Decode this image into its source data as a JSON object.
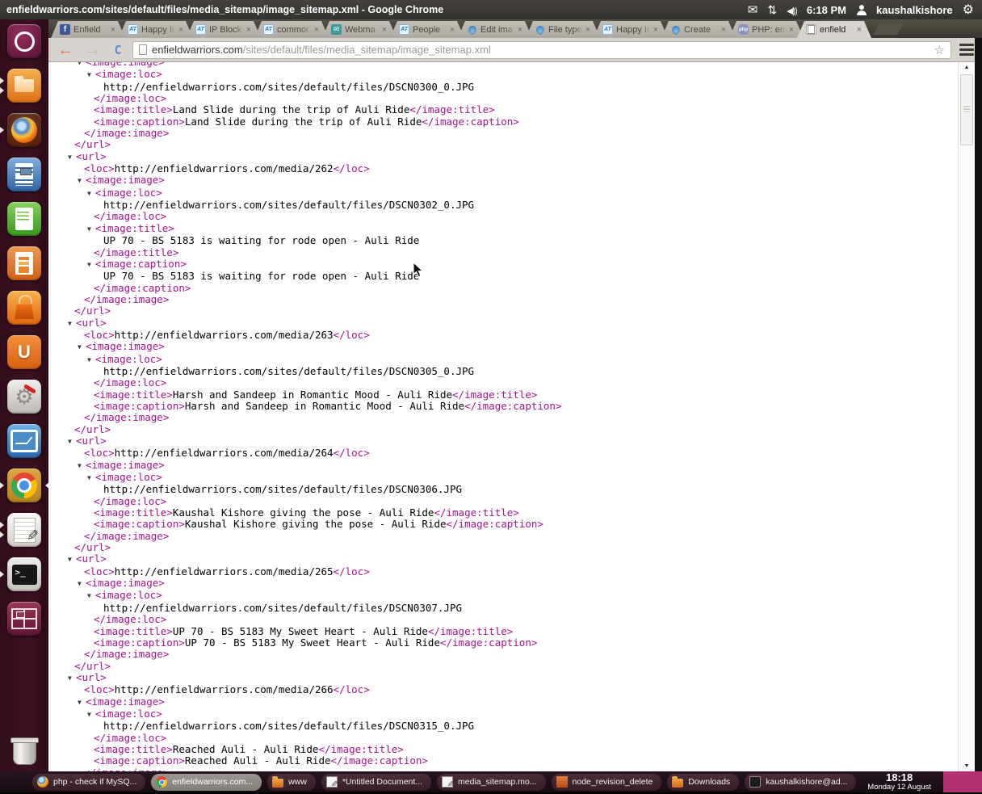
{
  "window": {
    "title": "enfieldwarriors.com/sites/default/files/media_sitemap/image_sitemap.xml - Google Chrome"
  },
  "tray": {
    "time": "6:18 PM",
    "user": "kaushalkishore",
    "icons": [
      "mail-icon",
      "sync-arrows-icon",
      "volume-icon",
      "user-icon",
      "session-gear-icon"
    ]
  },
  "tabs": [
    {
      "label": "Enfield",
      "favicon": "facebook",
      "active": false
    },
    {
      "label": "Happy Ir",
      "favicon": "at",
      "active": false
    },
    {
      "label": "IP Block",
      "favicon": "at",
      "active": false
    },
    {
      "label": "commor",
      "favicon": "at",
      "active": false
    },
    {
      "label": "Webma",
      "favicon": "webmail",
      "active": false
    },
    {
      "label": "People",
      "favicon": "at",
      "active": false
    },
    {
      "label": "Edit ima",
      "favicon": "drupal",
      "active": false
    },
    {
      "label": "File type",
      "favicon": "drupal",
      "active": false
    },
    {
      "label": "Happy Ir",
      "favicon": "at",
      "active": false
    },
    {
      "label": "Create",
      "favicon": "drupal",
      "active": false
    },
    {
      "label": "PHP: em",
      "favicon": "php",
      "active": false
    },
    {
      "label": "enfield",
      "favicon": "document",
      "active": true
    }
  ],
  "toolbar": {
    "url_host": "enfieldwarriors.com",
    "url_path": "/sites/default/files/media_sitemap/image_sitemap.xml"
  },
  "launcher": [
    {
      "name": "ubuntu-dash",
      "style": "ubuntu",
      "slot": 0,
      "pips": 0,
      "focused": false,
      "glyph": ""
    },
    {
      "name": "files",
      "style": "files",
      "slot": 1,
      "pips": 2,
      "focused": false,
      "glyph": ""
    },
    {
      "name": "firefox",
      "style": "firefox",
      "slot": 2,
      "pips": 1,
      "focused": false,
      "glyph": ""
    },
    {
      "name": "libreoffice-writer",
      "style": "writer",
      "slot": 3,
      "pips": 0,
      "focused": false,
      "glyph": ""
    },
    {
      "name": "libreoffice-calc",
      "style": "calc",
      "slot": 4,
      "pips": 0,
      "focused": false,
      "glyph": ""
    },
    {
      "name": "libreoffice-impress",
      "style": "impress",
      "slot": 5,
      "pips": 0,
      "focused": false,
      "glyph": ""
    },
    {
      "name": "software-center",
      "style": "usc",
      "slot": 6,
      "pips": 0,
      "focused": false,
      "glyph": ""
    },
    {
      "name": "ubuntu-one",
      "style": "uone",
      "slot": 7,
      "pips": 0,
      "focused": false,
      "glyph": "U"
    },
    {
      "name": "system-settings",
      "style": "settings",
      "slot": 8,
      "pips": 0,
      "focused": false,
      "glyph": ""
    },
    {
      "name": "system-monitor",
      "style": "monitor",
      "slot": 9,
      "pips": 0,
      "focused": false,
      "glyph": ""
    },
    {
      "name": "google-chrome",
      "style": "chrome",
      "slot": 10,
      "pips": 1,
      "focused": true,
      "glyph": ""
    },
    {
      "name": "gedit",
      "style": "gedit",
      "slot": 11,
      "pips": 2,
      "focused": false,
      "glyph": ""
    },
    {
      "name": "terminal",
      "style": "terminal",
      "slot": 12,
      "pips": 1,
      "focused": false,
      "glyph": ">_"
    },
    {
      "name": "workspace-switcher",
      "style": "workspace",
      "slot": 13,
      "pips": 0,
      "focused": false,
      "glyph": ""
    },
    {
      "name": "trash",
      "style": "trash",
      "slot": 16,
      "pips": 0,
      "focused": false,
      "glyph": ""
    }
  ],
  "xml": {
    "tag_color": "#a3148c",
    "lines": [
      {
        "a": 1,
        "i": 1,
        "s": [
          [
            "t",
            "<image:image>"
          ]
        ]
      },
      {
        "a": 1,
        "i": 2,
        "s": [
          [
            "t",
            "<image:loc>"
          ]
        ]
      },
      {
        "a": 0,
        "i": 3,
        "s": [
          [
            "x",
            "http://enfieldwarriors.com/sites/default/files/DSCN0300_0.JPG"
          ]
        ]
      },
      {
        "a": 0,
        "i": 2,
        "s": [
          [
            "t",
            "</image:loc>"
          ]
        ]
      },
      {
        "a": 0,
        "i": 2,
        "s": [
          [
            "t",
            "<image:title>"
          ],
          [
            "x",
            "Land Slide during the trip of Auli Ride"
          ],
          [
            "t",
            "</image:title>"
          ]
        ]
      },
      {
        "a": 0,
        "i": 2,
        "s": [
          [
            "t",
            "<image:caption>"
          ],
          [
            "x",
            "Land Slide during the trip of Auli Ride"
          ],
          [
            "t",
            "</image:caption>"
          ]
        ]
      },
      {
        "a": 0,
        "i": 1,
        "s": [
          [
            "t",
            "</image:image>"
          ]
        ]
      },
      {
        "a": 0,
        "i": 0,
        "s": [
          [
            "t",
            "</url>"
          ]
        ]
      },
      {
        "a": 1,
        "i": 0,
        "s": [
          [
            "t",
            "<url>"
          ]
        ]
      },
      {
        "a": 0,
        "i": 1,
        "s": [
          [
            "t",
            "<loc>"
          ],
          [
            "x",
            "http://enfieldwarriors.com/media/262"
          ],
          [
            "t",
            "</loc>"
          ]
        ]
      },
      {
        "a": 1,
        "i": 1,
        "s": [
          [
            "t",
            "<image:image>"
          ]
        ]
      },
      {
        "a": 1,
        "i": 2,
        "s": [
          [
            "t",
            "<image:loc>"
          ]
        ]
      },
      {
        "a": 0,
        "i": 3,
        "s": [
          [
            "x",
            "http://enfieldwarriors.com/sites/default/files/DSCN0302_0.JPG"
          ]
        ]
      },
      {
        "a": 0,
        "i": 2,
        "s": [
          [
            "t",
            "</image:loc>"
          ]
        ]
      },
      {
        "a": 1,
        "i": 2,
        "s": [
          [
            "t",
            "<image:title>"
          ]
        ]
      },
      {
        "a": 0,
        "i": 3,
        "s": [
          [
            "x",
            "UP 70 - BS 5183 is waiting for rode open - Auli Ride"
          ]
        ]
      },
      {
        "a": 0,
        "i": 2,
        "s": [
          [
            "t",
            "</image:title>"
          ]
        ]
      },
      {
        "a": 1,
        "i": 2,
        "s": [
          [
            "t",
            "<image:caption>"
          ]
        ]
      },
      {
        "a": 0,
        "i": 3,
        "s": [
          [
            "x",
            "UP 70 - BS 5183 is waiting for rode open - Auli Ride"
          ]
        ]
      },
      {
        "a": 0,
        "i": 2,
        "s": [
          [
            "t",
            "</image:caption>"
          ]
        ]
      },
      {
        "a": 0,
        "i": 1,
        "s": [
          [
            "t",
            "</image:image>"
          ]
        ]
      },
      {
        "a": 0,
        "i": 0,
        "s": [
          [
            "t",
            "</url>"
          ]
        ]
      },
      {
        "a": 1,
        "i": 0,
        "s": [
          [
            "t",
            "<url>"
          ]
        ]
      },
      {
        "a": 0,
        "i": 1,
        "s": [
          [
            "t",
            "<loc>"
          ],
          [
            "x",
            "http://enfieldwarriors.com/media/263"
          ],
          [
            "t",
            "</loc>"
          ]
        ]
      },
      {
        "a": 1,
        "i": 1,
        "s": [
          [
            "t",
            "<image:image>"
          ]
        ]
      },
      {
        "a": 1,
        "i": 2,
        "s": [
          [
            "t",
            "<image:loc>"
          ]
        ]
      },
      {
        "a": 0,
        "i": 3,
        "s": [
          [
            "x",
            "http://enfieldwarriors.com/sites/default/files/DSCN0305_0.JPG"
          ]
        ]
      },
      {
        "a": 0,
        "i": 2,
        "s": [
          [
            "t",
            "</image:loc>"
          ]
        ]
      },
      {
        "a": 0,
        "i": 2,
        "s": [
          [
            "t",
            "<image:title>"
          ],
          [
            "x",
            "Harsh and Sandeep in Romantic Mood - Auli Ride"
          ],
          [
            "t",
            "</image:title>"
          ]
        ]
      },
      {
        "a": 0,
        "i": 2,
        "s": [
          [
            "t",
            "<image:caption>"
          ],
          [
            "x",
            "Harsh and Sandeep in Romantic Mood - Auli Ride"
          ],
          [
            "t",
            "</image:caption>"
          ]
        ]
      },
      {
        "a": 0,
        "i": 1,
        "s": [
          [
            "t",
            "</image:image>"
          ]
        ]
      },
      {
        "a": 0,
        "i": 0,
        "s": [
          [
            "t",
            "</url>"
          ]
        ]
      },
      {
        "a": 1,
        "i": 0,
        "s": [
          [
            "t",
            "<url>"
          ]
        ]
      },
      {
        "a": 0,
        "i": 1,
        "s": [
          [
            "t",
            "<loc>"
          ],
          [
            "x",
            "http://enfieldwarriors.com/media/264"
          ],
          [
            "t",
            "</loc>"
          ]
        ]
      },
      {
        "a": 1,
        "i": 1,
        "s": [
          [
            "t",
            "<image:image>"
          ]
        ]
      },
      {
        "a": 1,
        "i": 2,
        "s": [
          [
            "t",
            "<image:loc>"
          ]
        ]
      },
      {
        "a": 0,
        "i": 3,
        "s": [
          [
            "x",
            "http://enfieldwarriors.com/sites/default/files/DSCN0306.JPG"
          ]
        ]
      },
      {
        "a": 0,
        "i": 2,
        "s": [
          [
            "t",
            "</image:loc>"
          ]
        ]
      },
      {
        "a": 0,
        "i": 2,
        "s": [
          [
            "t",
            "<image:title>"
          ],
          [
            "x",
            "Kaushal Kishore giving the pose - Auli Ride"
          ],
          [
            "t",
            "</image:title>"
          ]
        ]
      },
      {
        "a": 0,
        "i": 2,
        "s": [
          [
            "t",
            "<image:caption>"
          ],
          [
            "x",
            "Kaushal Kishore giving the pose - Auli Ride"
          ],
          [
            "t",
            "</image:caption>"
          ]
        ]
      },
      {
        "a": 0,
        "i": 1,
        "s": [
          [
            "t",
            "</image:image>"
          ]
        ]
      },
      {
        "a": 0,
        "i": 0,
        "s": [
          [
            "t",
            "</url>"
          ]
        ]
      },
      {
        "a": 1,
        "i": 0,
        "s": [
          [
            "t",
            "<url>"
          ]
        ]
      },
      {
        "a": 0,
        "i": 1,
        "s": [
          [
            "t",
            "<loc>"
          ],
          [
            "x",
            "http://enfieldwarriors.com/media/265"
          ],
          [
            "t",
            "</loc>"
          ]
        ]
      },
      {
        "a": 1,
        "i": 1,
        "s": [
          [
            "t",
            "<image:image>"
          ]
        ]
      },
      {
        "a": 1,
        "i": 2,
        "s": [
          [
            "t",
            "<image:loc>"
          ]
        ]
      },
      {
        "a": 0,
        "i": 3,
        "s": [
          [
            "x",
            "http://enfieldwarriors.com/sites/default/files/DSCN0307.JPG"
          ]
        ]
      },
      {
        "a": 0,
        "i": 2,
        "s": [
          [
            "t",
            "</image:loc>"
          ]
        ]
      },
      {
        "a": 0,
        "i": 2,
        "s": [
          [
            "t",
            "<image:title>"
          ],
          [
            "x",
            "UP 70 - BS 5183 My Sweet Heart - Auli Ride"
          ],
          [
            "t",
            "</image:title>"
          ]
        ]
      },
      {
        "a": 0,
        "i": 2,
        "s": [
          [
            "t",
            "<image:caption>"
          ],
          [
            "x",
            "UP 70 - BS 5183 My Sweet Heart - Auli Ride"
          ],
          [
            "t",
            "</image:caption>"
          ]
        ]
      },
      {
        "a": 0,
        "i": 1,
        "s": [
          [
            "t",
            "</image:image>"
          ]
        ]
      },
      {
        "a": 0,
        "i": 0,
        "s": [
          [
            "t",
            "</url>"
          ]
        ]
      },
      {
        "a": 1,
        "i": 0,
        "s": [
          [
            "t",
            "<url>"
          ]
        ]
      },
      {
        "a": 0,
        "i": 1,
        "s": [
          [
            "t",
            "<loc>"
          ],
          [
            "x",
            "http://enfieldwarriors.com/media/266"
          ],
          [
            "t",
            "</loc>"
          ]
        ]
      },
      {
        "a": 1,
        "i": 1,
        "s": [
          [
            "t",
            "<image:image>"
          ]
        ]
      },
      {
        "a": 1,
        "i": 2,
        "s": [
          [
            "t",
            "<image:loc>"
          ]
        ]
      },
      {
        "a": 0,
        "i": 3,
        "s": [
          [
            "x",
            "http://enfieldwarriors.com/sites/default/files/DSCN0315_0.JPG"
          ]
        ]
      },
      {
        "a": 0,
        "i": 2,
        "s": [
          [
            "t",
            "</image:loc>"
          ]
        ]
      },
      {
        "a": 0,
        "i": 2,
        "s": [
          [
            "t",
            "<image:title>"
          ],
          [
            "x",
            "Reached Auli - Auli Ride"
          ],
          [
            "t",
            "</image:title>"
          ]
        ]
      },
      {
        "a": 0,
        "i": 2,
        "s": [
          [
            "t",
            "<image:caption>"
          ],
          [
            "x",
            "Reached Auli - Auli Ride"
          ],
          [
            "t",
            "</image:caption>"
          ]
        ]
      },
      {
        "a": 0,
        "i": 1,
        "s": [
          [
            "t",
            "</image:image>"
          ]
        ]
      }
    ]
  },
  "taskbar": {
    "buttons": [
      {
        "label": "php - check if MySQ...",
        "icon": "firefox",
        "active": false
      },
      {
        "label": "enfieldwarriors.com...",
        "icon": "chrome",
        "active": true
      },
      {
        "label": "www",
        "icon": "folder",
        "active": false
      },
      {
        "label": "*Untitled Document...",
        "icon": "gedit",
        "active": false
      },
      {
        "label": "media_sitemap.mo...",
        "icon": "gedit",
        "active": false
      },
      {
        "label": "node_revision_delete",
        "icon": "folder-red",
        "active": false
      },
      {
        "label": "Downloads",
        "icon": "folder",
        "active": false
      },
      {
        "label": "kaushalkishore@ad...",
        "icon": "terminal",
        "active": false
      }
    ],
    "clock": {
      "time": "18:18",
      "date": "Monday 12 August"
    }
  },
  "colors": {
    "xml_tag": "#a3148c",
    "launcher_bg": "#36101e",
    "taskbar_active_bg": "#8f8a84",
    "pink_block": "#b13070",
    "back_arrow": "#e8702a"
  }
}
